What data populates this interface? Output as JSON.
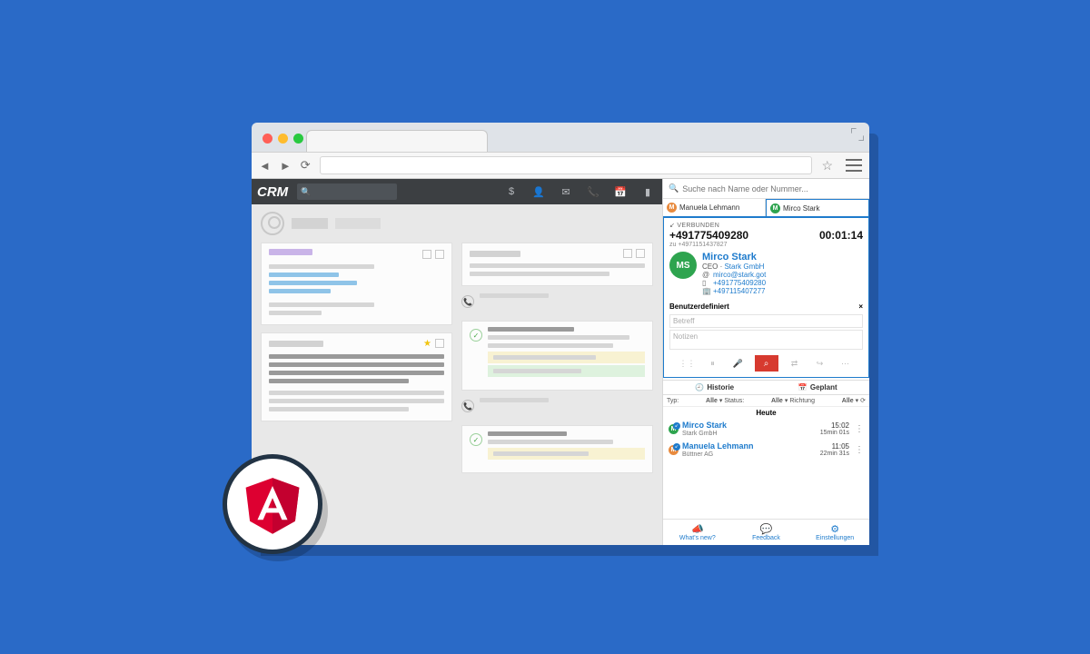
{
  "app": {
    "logo": "CRM"
  },
  "cti": {
    "search_placeholder": "Suche nach Name oder Nummer...",
    "tabs": [
      {
        "initial": "M",
        "name": "Manuela Lehmann"
      },
      {
        "initial": "M",
        "name": "Mirco Stark"
      }
    ],
    "call": {
      "status": "VERBUNDEN",
      "number": "+491775409280",
      "to_label": "zu",
      "to_number": "+4971151437827",
      "timer": "00:01:14"
    },
    "contact": {
      "initials": "MS",
      "name": "Mirco Stark",
      "role": "CEO",
      "company": "Stark GmbH",
      "email": "mirco@stark.got",
      "mobile": "+491775409280",
      "phone": "+497115407277"
    },
    "notes": {
      "header": "Benutzerdefiniert",
      "subject_ph": "Betreff",
      "body_ph": "Notizen"
    },
    "history_tabs": {
      "history": "Historie",
      "planned": "Geplant"
    },
    "filters": {
      "type_label": "Typ:",
      "type_value": "Alle",
      "status_label": "Status:",
      "status_value": "Alle",
      "dir_label": "Richtung",
      "dir_value": "Alle"
    },
    "day": "Heute",
    "log": [
      {
        "initial": "M",
        "name": "Mirco Stark",
        "company": "Stark GmbH",
        "time": "15:02",
        "duration": "15min 01s",
        "avclass": "gr"
      },
      {
        "initial": "M",
        "name": "Manuela Lehmann",
        "company": "Büttner AG",
        "time": "11:05",
        "duration": "22min 31s",
        "avclass": "or"
      }
    ],
    "footer": {
      "whatsnew": "What's new?",
      "feedback": "Feedback",
      "settings": "Einstellungen"
    }
  }
}
